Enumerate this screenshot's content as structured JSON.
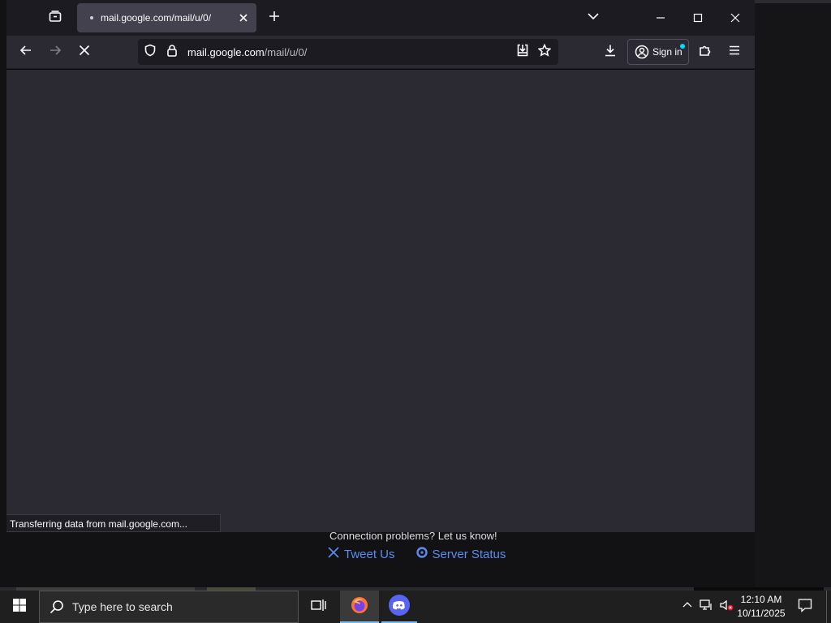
{
  "browser": {
    "tab": {
      "title": "mail.google.com/mail/u/0/"
    },
    "url": {
      "host": "mail.google.com",
      "path": "/mail/u/0/"
    },
    "signin_label": "Sign in",
    "status_text": "Transferring data from mail.google.com..."
  },
  "background_app": {
    "message": "Connection problems? Let us know!",
    "tweet_label": "Tweet Us",
    "server_status_label": "Server Status"
  },
  "taskbar": {
    "search_placeholder": "Type here to search",
    "time": "12:10 AM",
    "date": "10/11/2025"
  },
  "colors": {
    "accent": "#00ddff",
    "link": "#5b8def",
    "taskbar_active": "#76b9ed"
  }
}
